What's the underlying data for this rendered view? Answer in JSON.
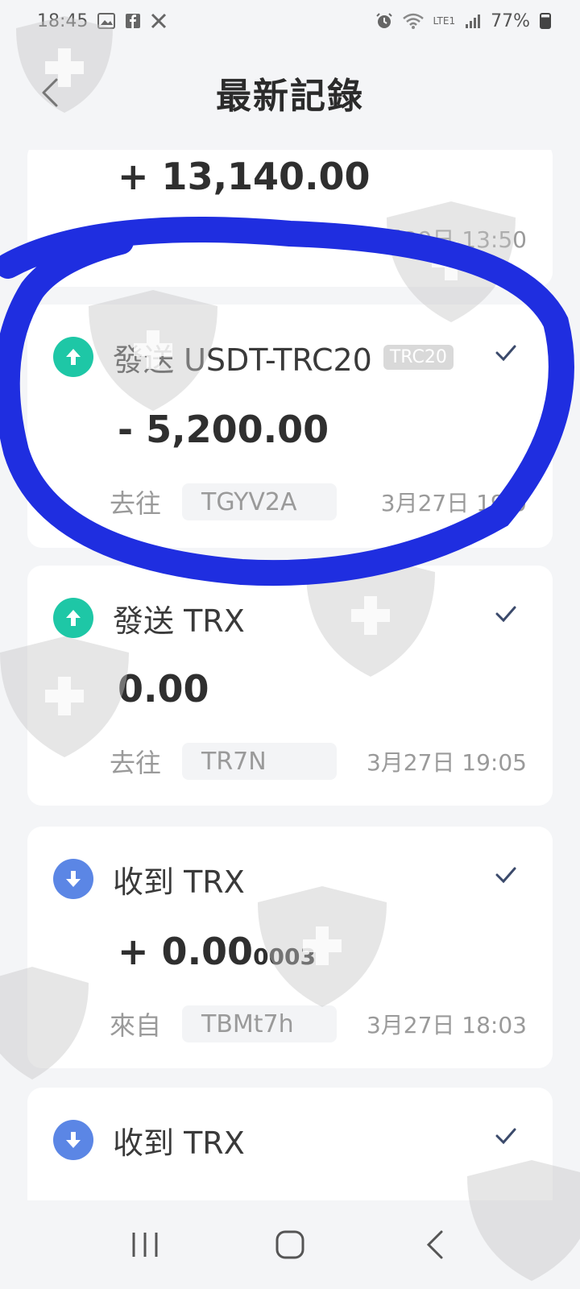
{
  "status_bar": {
    "time": "18:45",
    "battery": "77%",
    "network": "LTE1"
  },
  "header": {
    "title": "最新記錄"
  },
  "transactions": [
    {
      "title": "",
      "amount": "+ 13,140.00",
      "time": "3月29日 13:50"
    },
    {
      "title": "發送 USDT-TRC20",
      "badge": "TRC20",
      "amount": "- 5,200.00",
      "direction_label": "去往",
      "address": "TGYV2A",
      "time": "3月27日 19:0"
    },
    {
      "title": "發送 TRX",
      "amount": "0.00",
      "direction_label": "去往",
      "address": "TR7N",
      "time": "3月27日 19:05"
    },
    {
      "title": "收到 TRX",
      "amount_main": "+ 0.00",
      "amount_small": "0003",
      "direction_label": "來自",
      "address": "TBMt7h",
      "time": "3月27日 18:03"
    },
    {
      "title": "收到 TRX"
    }
  ],
  "colors": {
    "send_icon": "#1ec7a6",
    "receive_icon": "#5b86e5",
    "annotation_circle": "#1f2ee0",
    "watermark": "#c8c8c8"
  },
  "icons": {
    "back": "chevron-left-icon",
    "send": "arrow-up-icon",
    "receive": "arrow-down-icon",
    "status": "checkmark-icon",
    "nav_recent": "recent-apps-icon",
    "nav_home": "home-icon",
    "nav_back": "back-icon"
  }
}
